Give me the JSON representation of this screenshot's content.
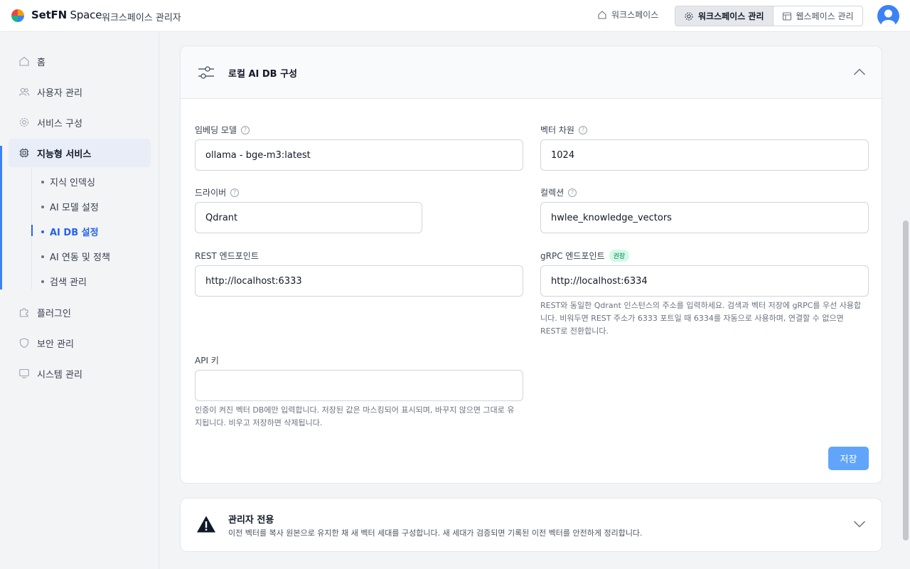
{
  "header": {
    "brand_bold": "SetFN",
    "brand_light": " Space",
    "subtitle": "워크스페이스 관리자",
    "nav_workspace": "워크스페이스",
    "tab_workspace_admin": "워크스페이스 관리",
    "tab_webspace_admin": "웹스페이스 관리"
  },
  "sidebar": {
    "items": [
      {
        "label": "홈",
        "icon": "home-icon"
      },
      {
        "label": "사용자 관리",
        "icon": "users-icon"
      },
      {
        "label": "서비스 구성",
        "icon": "gear-icon"
      },
      {
        "label": "지능형 서비스",
        "icon": "chip-icon"
      },
      {
        "label": "플러그인",
        "icon": "puzzle-icon"
      },
      {
        "label": "보안 관리",
        "icon": "shield-icon"
      },
      {
        "label": "시스템 관리",
        "icon": "monitor-icon"
      }
    ],
    "sub_items": [
      {
        "label": "지식 인덱싱"
      },
      {
        "label": "AI 모델 설정"
      },
      {
        "label": "AI DB 설정"
      },
      {
        "label": "AI 연동 및 정책"
      },
      {
        "label": "검색 관리"
      }
    ]
  },
  "panel": {
    "title": "로컬 AI DB 구성",
    "embedding_label": "임베딩 모델",
    "embedding_value": "ollama - bge-m3:latest",
    "vector_dim_label": "벡터 차원",
    "vector_dim_value": "1024",
    "driver_label": "드라이버",
    "driver_value": "Qdrant",
    "collection_label": "컬렉션",
    "collection_value": "hwlee_knowledge_vectors",
    "rest_label": "REST 엔드포인트",
    "rest_value": "http://localhost:6333",
    "grpc_label": "gRPC 엔드포인트",
    "grpc_badge": "권장",
    "grpc_value": "http://localhost:6334",
    "grpc_help_1": "REST와 동일한 Qdrant 인스턴스의 주소를 입력하세요. 검색과 벡터 저장에 gRPC를 우선 사용합",
    "grpc_help_2": "니다. 비워두면 REST 주소가 6333 포트일 때 6334를 자동으로 사용하며, 연결할 수 없으면",
    "grpc_help_3": "REST로 전환합니다.",
    "apikey_label": "API 키",
    "apikey_value": "",
    "apikey_help_1": "인증이 켜진 벡터 DB에만 입력합니다. 저장된 값은 마스킹되어 표시되며, 바꾸지 않으면 그대로 유",
    "apikey_help_2": "지됩니다. 비우고 저장하면 삭제됩니다.",
    "save_label": "저장"
  },
  "admin_panel": {
    "title": "관리자 전용",
    "desc": "이전 벡터를 복사 원본으로 유지한 채 새 벡터 세대를 구성합니다. 새 세대가 검증되면 기록된 이전 벡터를 안전하게 정리합니다."
  },
  "colors": {
    "accent": "#2563eb",
    "save_button": "#60a5fa",
    "badge_bg": "#d1fae5"
  }
}
